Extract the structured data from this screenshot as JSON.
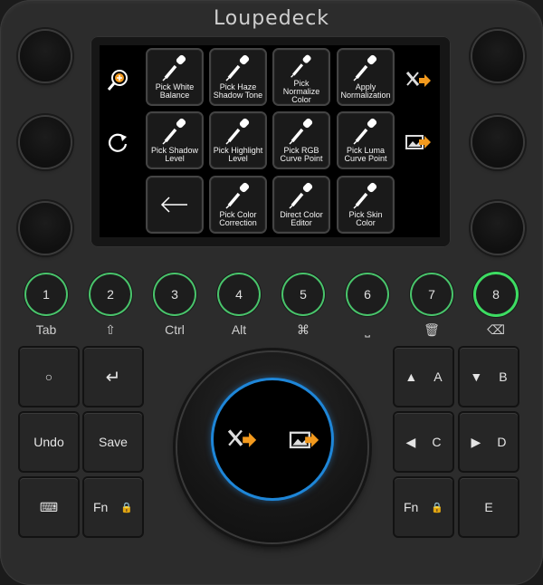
{
  "brand": "Loupedeck",
  "colors": {
    "accent_green": "#3ddc62",
    "ring_blue": "#1e86d8",
    "arrow_orange": "#f39a1e"
  },
  "screen": {
    "left_icons": [
      "zoom-in-icon",
      "rotate-icon"
    ],
    "right_icons": [
      "tools-arrow-icon",
      "image-arrow-icon"
    ],
    "tiles": [
      {
        "l1": "Pick White",
        "l2": "Balance",
        "icon": "eyedropper-icon"
      },
      {
        "l1": "Pick Haze",
        "l2": "Shadow Tone",
        "icon": "eyedropper-icon"
      },
      {
        "l1": "Pick Normalize",
        "l2": "Color",
        "icon": "eyedropper-icon"
      },
      {
        "l1": "Apply",
        "l2": "Normalization",
        "icon": "eyedropper-icon"
      },
      {
        "l1": "Pick Shadow",
        "l2": "Level",
        "icon": "eyedropper-icon"
      },
      {
        "l1": "Pick Highlight",
        "l2": "Level",
        "icon": "eyedropper-icon"
      },
      {
        "l1": "Pick RGB",
        "l2": "Curve Point",
        "icon": "eyedropper-icon"
      },
      {
        "l1": "Pick Luma",
        "l2": "Curve Point",
        "icon": "eyedropper-icon"
      },
      {
        "l1": "",
        "l2": "",
        "icon": "back-arrow-icon"
      },
      {
        "l1": "Pick Color",
        "l2": "Correction",
        "icon": "eyedropper-icon"
      },
      {
        "l1": "Direct Color",
        "l2": "Editor",
        "icon": "eyedropper-icon"
      },
      {
        "l1": "Pick Skin",
        "l2": "Color",
        "icon": "eyedropper-icon"
      }
    ]
  },
  "number_buttons": [
    "1",
    "2",
    "3",
    "4",
    "5",
    "6",
    "7",
    "8"
  ],
  "number_labels": [
    "Tab",
    "⇧",
    "Ctrl",
    "Alt",
    "⌘",
    "⎵",
    "🗑",
    "⌫"
  ],
  "left_keys": [
    "○",
    "↵",
    "Undo",
    "Save",
    "⌨",
    "Fn"
  ],
  "right_keys": [
    {
      "glyph": "▲",
      "letter": "A"
    },
    {
      "glyph": "▼",
      "letter": "B"
    },
    {
      "glyph": "◀",
      "letter": "C"
    },
    {
      "glyph": "▶",
      "letter": "D"
    },
    {
      "glyph": "Fn",
      "letter": ""
    },
    {
      "glyph": "",
      "letter": "E"
    }
  ]
}
